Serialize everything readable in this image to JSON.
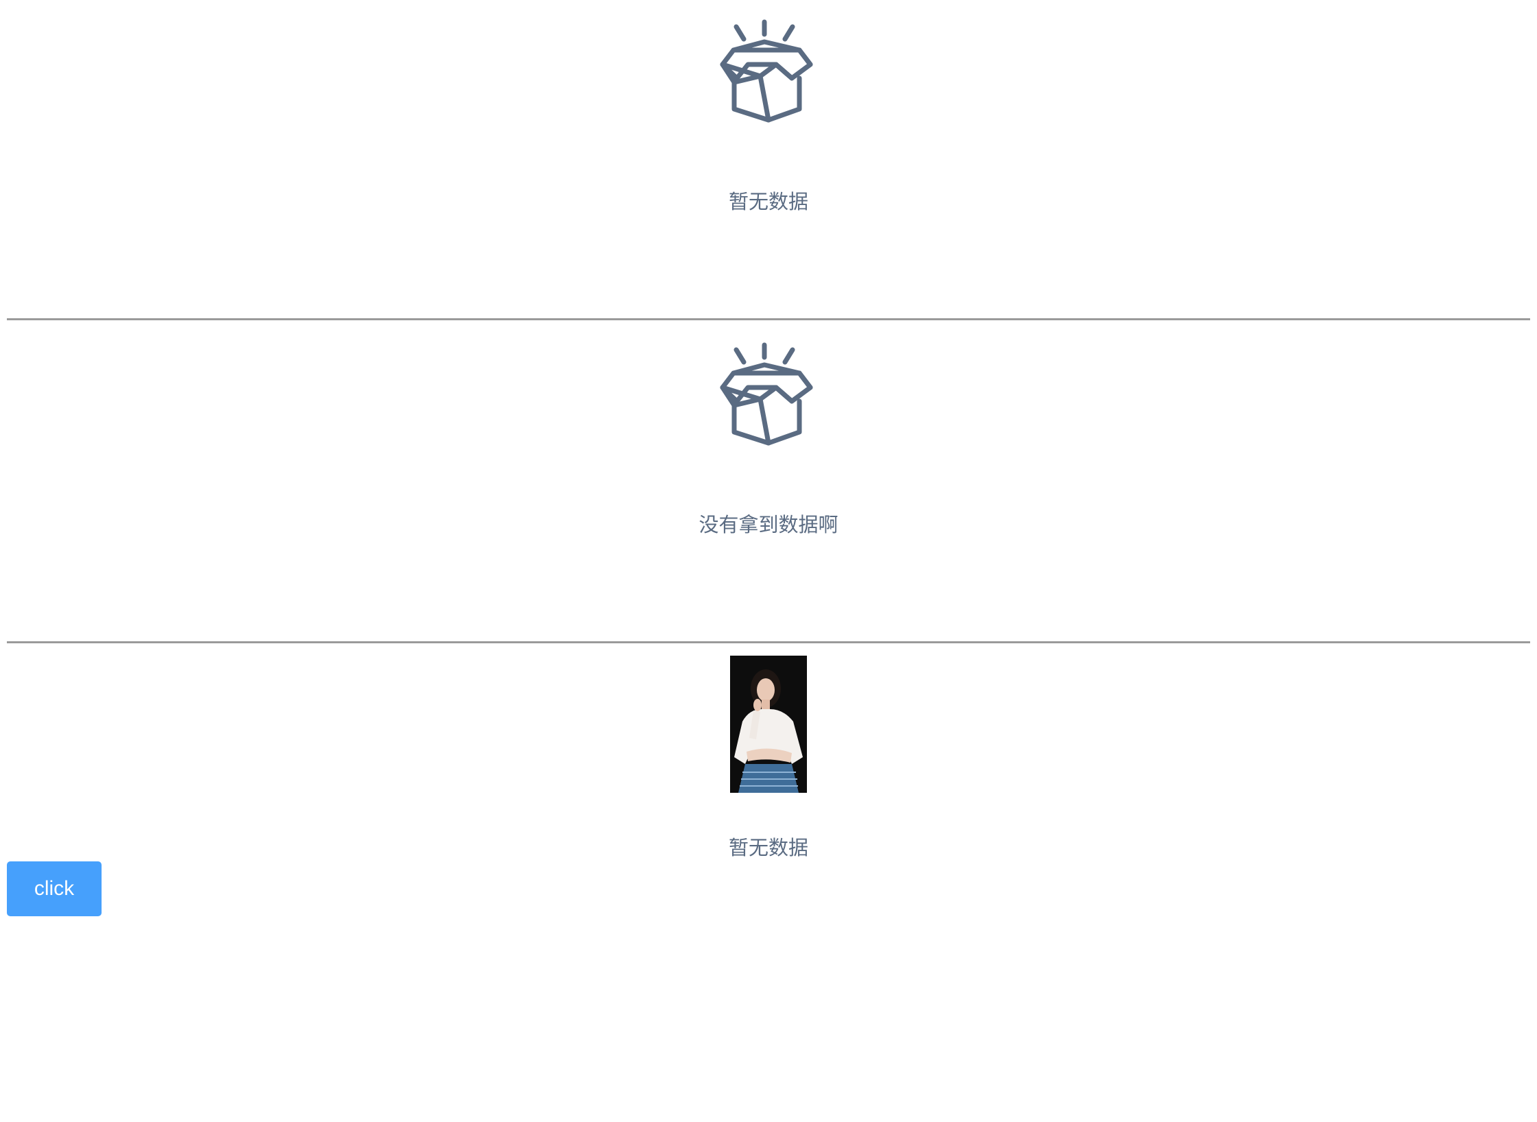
{
  "empty_states": [
    {
      "icon": "empty-box-icon",
      "text": "暂无数据"
    },
    {
      "icon": "empty-box-icon",
      "text": "没有拿到数据啊"
    },
    {
      "image": "portrait-photo",
      "text": "暂无数据"
    }
  ],
  "button": {
    "label": "click"
  },
  "colors": {
    "icon": "#5a6b82",
    "text": "#5a6b82",
    "button": "#46a0fc",
    "divider": "#9a9a9a"
  }
}
